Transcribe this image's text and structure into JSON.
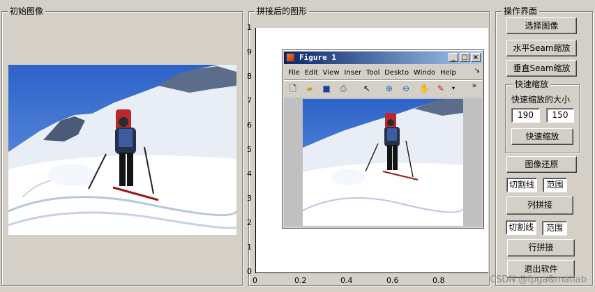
{
  "groups": {
    "initial": "初始图像",
    "stitched": "拼接后的图形",
    "operations": "操作界面",
    "quick_scale": "快速缩放"
  },
  "buttons": {
    "select_image": "选择图像",
    "horizontal_seam": "水平Seam缩放",
    "vertical_seam": "垂直Seam缩放",
    "quick_scale": "快速缩放",
    "restore": "图像还原",
    "column_stitch": "列拼接",
    "row_stitch": "行拼接",
    "exit": "退出软件"
  },
  "quick_scale": {
    "size_label": "快速缩放的大小",
    "width": "190",
    "height": "150"
  },
  "column": {
    "cut_line": "切割线",
    "range": "范围"
  },
  "row": {
    "cut_line": "切割线",
    "range": "范围"
  },
  "axes": {
    "x_ticks": [
      "0",
      "0.2",
      "0.4",
      "0.6",
      "0.8"
    ],
    "y_ticks": [
      "1",
      "9",
      "8",
      "7",
      "6",
      "5",
      "4",
      "3",
      "2",
      "1",
      "0"
    ]
  },
  "figure": {
    "title": "Figure 1",
    "menu": [
      "File",
      "Edit",
      "View",
      "Inser",
      "Tool",
      "Deskto",
      "Windo",
      "Help"
    ]
  },
  "watermark": "CSDN @fpga&matlab"
}
